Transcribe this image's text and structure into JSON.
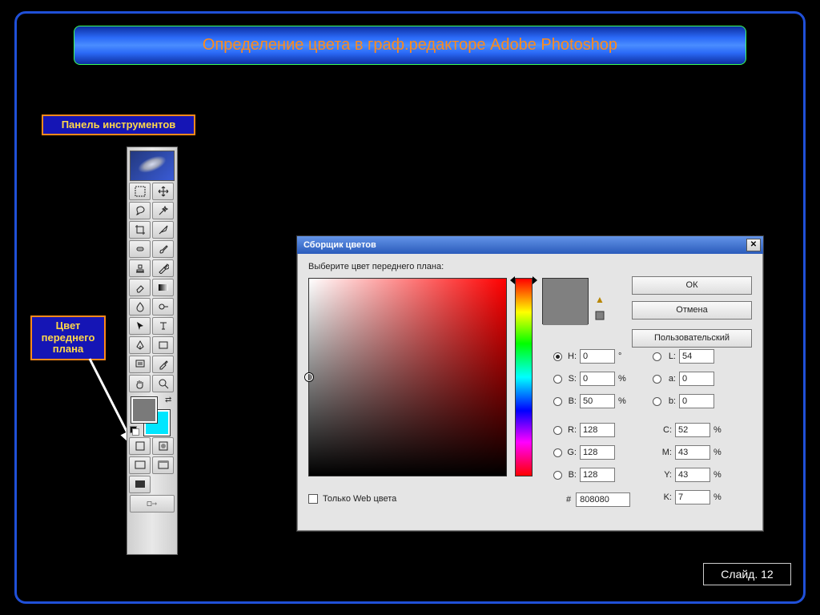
{
  "title": "Определение цвета в граф.редакторе Adobe Photoshop",
  "labels": {
    "tool_panel": "Панель инструментов",
    "fg_color": "Цвет переднего плана",
    "slide": "Слайд. 12"
  },
  "dialog": {
    "title": "Сборщик цветов",
    "prompt": "Выберите цвет переднего плана:",
    "buttons": {
      "ok": "ОК",
      "cancel": "Отмена",
      "custom": "Пользовательский"
    },
    "webonly": "Только Web цвета",
    "vals": {
      "H": "0",
      "S": "0",
      "B": "50",
      "L": "54",
      "a": "0",
      "b": "0",
      "R": "128",
      "G": "128",
      "Bc": "128",
      "C": "52",
      "M": "43",
      "Y": "43",
      "K": "7",
      "hex": "808080"
    },
    "labels": {
      "H": "H:",
      "S": "S:",
      "B": "B:",
      "L": "L:",
      "a": "a:",
      "b": "b:",
      "R": "R:",
      "G": "G:",
      "Bc": "B:",
      "C": "C:",
      "M": "M:",
      "Y": "Y:",
      "K": "K:",
      "deg": "°",
      "pct": "%",
      "hash": "#"
    }
  },
  "colors": {
    "fg": "#7a7a7a",
    "bg": "#00e6ff"
  }
}
